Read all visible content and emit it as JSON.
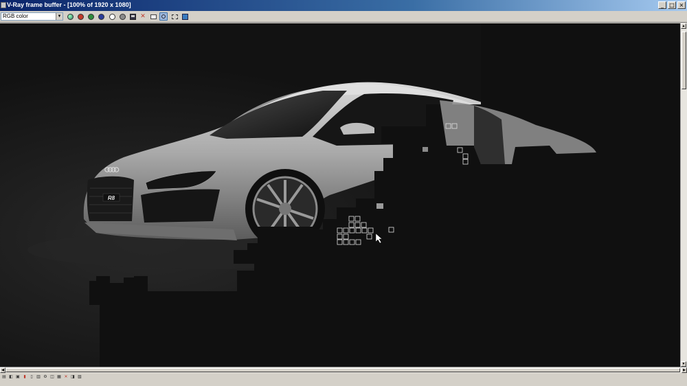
{
  "window": {
    "title": "V-Ray frame buffer - [100% of 1920 x 1080]",
    "minimize": "_",
    "maximize": "□",
    "close": "×"
  },
  "toolbar": {
    "channel_select": "RGB color",
    "buttons": [
      {
        "name": "save-image-icon"
      },
      {
        "name": "red-channel-button",
        "color": "#c0392b"
      },
      {
        "name": "green-channel-button",
        "color": "#2e8b3d"
      },
      {
        "name": "blue-channel-button",
        "color": "#2a3c9a"
      },
      {
        "name": "alpha-channel-button",
        "color": "#ffffff"
      },
      {
        "name": "monochrome-button",
        "color": "#8a8a8a"
      },
      {
        "name": "save-icon"
      },
      {
        "name": "clear-image-icon",
        "glyph": "✕"
      },
      {
        "name": "duplicate-to-mtl-editor-icon"
      },
      {
        "name": "track-mouse-icon"
      },
      {
        "name": "region-render-icon"
      },
      {
        "name": "render-last-icon"
      }
    ]
  },
  "render": {
    "badge_text": "R8"
  },
  "statusbar": {
    "text": ""
  }
}
